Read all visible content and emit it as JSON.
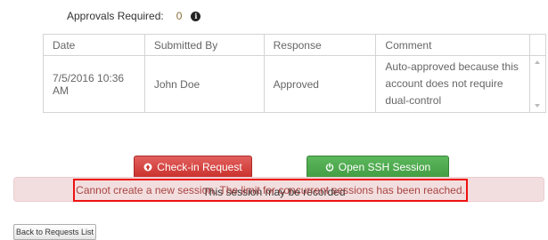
{
  "approvals": {
    "label": "Approvals Required:",
    "value": "0",
    "info_icon": "info-circle-icon"
  },
  "table": {
    "headers": [
      "Date",
      "Submitted By",
      "Response",
      "Comment"
    ],
    "rows": [
      {
        "date": "7/5/2016 10:36 AM",
        "submitted_by": "John Doe",
        "response": "Approved",
        "comment": "Auto-approved because this account does not require dual-control"
      }
    ]
  },
  "buttons": {
    "checkin": {
      "label": "Check-in Request",
      "icon": "circle-arrow-icon",
      "color": "#d9534f"
    },
    "ssh": {
      "label": "Open SSH Session",
      "icon": "power-icon",
      "color": "#5cb85c"
    },
    "back": {
      "label": "Back to Requests List"
    }
  },
  "recording_notice": "This session may be recorded",
  "alert": {
    "message": "Cannot create a new session. The limit for concurrent sessions has been reached.",
    "color": "#a94442",
    "background": "#f2dede",
    "highlight_color": "#ee1111"
  }
}
